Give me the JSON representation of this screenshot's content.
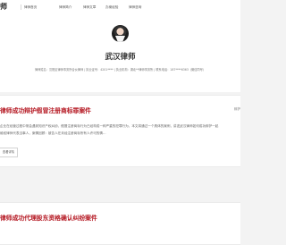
{
  "header": {
    "logo_text": "师",
    "nav": [
      "律师首页",
      "律师简介",
      "律师文章",
      "办案经验",
      "律师咨询"
    ]
  },
  "profile": {
    "name": "武汉律师",
    "info": "律师姓名：汉阳区律师事务所合伙律师 | 执业证号：4201**** | 执业机构：湖北**律师事务所 | 联系电话：187****6363（微信同号）"
  },
  "articles": [
    {
      "title": "律师成功辩护假冒注册商标罪案件",
      "tag": "辩护",
      "excerpt_lines": [
        "企业在经营过程中常会遇到知识产权纠纷，假冒注册商标行为已经构成一种严重的犯罪行为，本文将通过一个具体的案例，讲述武汉律师如何成功辩护一起",
        "维权律师代表当事人，案情回顾：被告人在未经注册商标所有人许可的情…"
      ],
      "read_more": "查看详情"
    },
    {
      "title": "律师成功代理股东资格确认纠纷案件",
      "tag": "",
      "excerpt_lines": [],
      "read_more": ""
    }
  ]
}
